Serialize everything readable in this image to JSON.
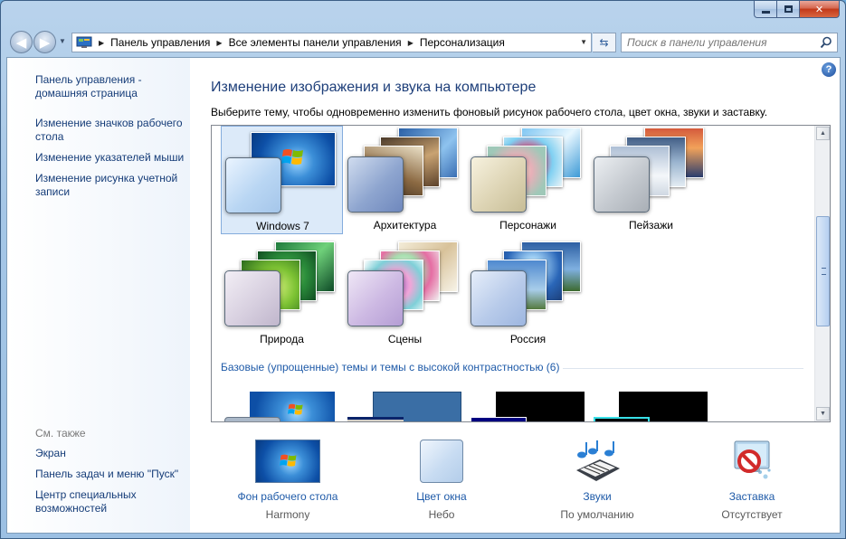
{
  "window": {
    "minimize_label": "—",
    "maximize_label": "□",
    "close_label": "✕"
  },
  "address": {
    "crumbs": [
      "Панель управления",
      "Все элементы панели управления",
      "Персонализация"
    ]
  },
  "search": {
    "placeholder": "Поиск в панели управления"
  },
  "sidebar": {
    "links": [
      {
        "label": "Панель управления - домашняя страница"
      },
      {
        "label": "Изменение значков рабочего стола"
      },
      {
        "label": "Изменение указателей мыши"
      },
      {
        "label": "Изменение рисунка учетной записи"
      }
    ],
    "see_also_heading": "См. также",
    "see_also": [
      {
        "label": "Экран"
      },
      {
        "label": "Панель задач и меню \"Пуск\""
      },
      {
        "label": "Центр специальных возможностей"
      }
    ]
  },
  "main": {
    "title": "Изменение изображения и звука на компьютере",
    "subtitle": "Выберите тему, чтобы одновременно изменить фоновый рисунок рабочего стола, цвет окна, звуки и заставку.",
    "themes": [
      {
        "label": "Windows 7",
        "selected": true
      },
      {
        "label": "Архитектура",
        "selected": false
      },
      {
        "label": "Персонажи",
        "selected": false
      },
      {
        "label": "Пейзажи",
        "selected": false
      },
      {
        "label": "Природа",
        "selected": false
      },
      {
        "label": "Сцены",
        "selected": false
      },
      {
        "label": "Россия",
        "selected": false
      }
    ],
    "basic_section_title": "Базовые (упрощенные) темы и темы с высокой контрастностью (6)",
    "help_label": "?"
  },
  "bottom": [
    {
      "title": "Фон рабочего стола",
      "value": "Harmony",
      "icon": "desktop-background-icon"
    },
    {
      "title": "Цвет окна",
      "value": "Небо",
      "icon": "window-color-icon"
    },
    {
      "title": "Звуки",
      "value": "По умолчанию",
      "icon": "sounds-icon"
    },
    {
      "title": "Заставка",
      "value": "Отсутствует",
      "icon": "screensaver-icon"
    }
  ],
  "colors": {
    "link": "#153c78",
    "section": "#1e5aa8",
    "title": "#1e3f7a",
    "selection": "#dceaf9"
  }
}
